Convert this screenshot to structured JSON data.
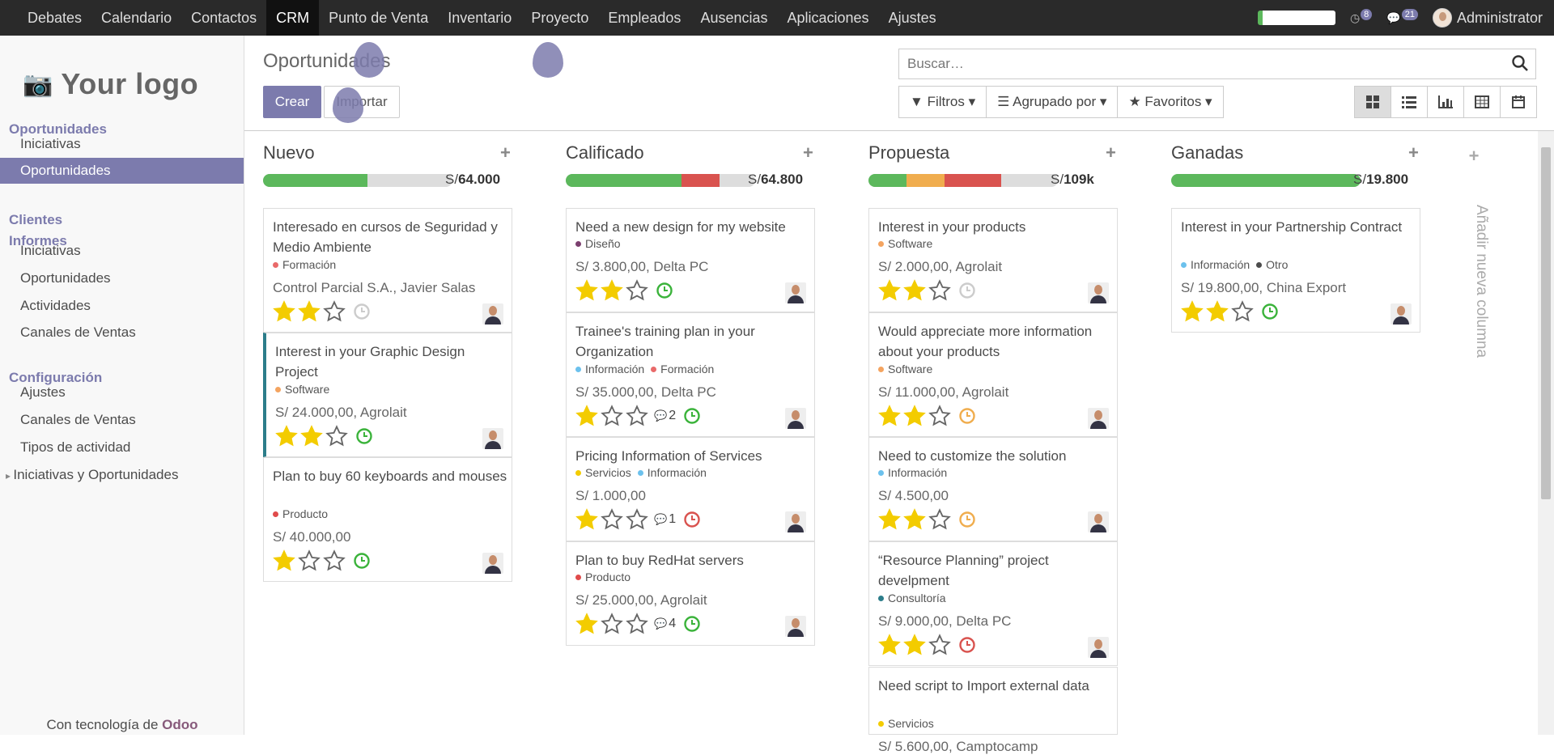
{
  "topbar": {
    "menu": [
      "Debates",
      "Calendario",
      "Contactos",
      "CRM",
      "Punto de Venta",
      "Inventario",
      "Proyecto",
      "Empleados",
      "Ausencias",
      "Aplicaciones",
      "Ajustes"
    ],
    "active_menu": "CRM",
    "activity_count": "8",
    "message_count": "21",
    "user": "Administrator"
  },
  "sidebar": {
    "logo_text": "Your logo",
    "sections": [
      {
        "title": "Oportunidades",
        "items": [
          "Iniciativas",
          "Oportunidades"
        ]
      },
      {
        "title": "Clientes",
        "items": []
      },
      {
        "title": "Informes",
        "items": [
          "Iniciativas",
          "Oportunidades",
          "Actividades",
          "Canales de Ventas"
        ]
      },
      {
        "title": "Configuración",
        "items": [
          "Ajustes",
          "Canales de Ventas",
          "Tipos de actividad",
          "Iniciativas y Oportunidades"
        ]
      }
    ],
    "active_item": "Oportunidades",
    "powered_prefix": "Con tecnología de",
    "powered_brand": "Odoo"
  },
  "control_panel": {
    "title": "Oportunidades",
    "create_label": "Crear",
    "import_label": "Importar",
    "search_placeholder": "Buscar…",
    "filters_label": "Filtros",
    "groupby_label": "Agrupado por",
    "favorites_label": "Favoritos",
    "views": [
      "kanban",
      "list",
      "graph",
      "pivot",
      "calendar"
    ],
    "active_view": "kanban"
  },
  "colors": {
    "brand": "#7c7bad",
    "green": "#5cb85c",
    "orange": "#f0ad4e",
    "red": "#d9534f",
    "star": "#f3cc00"
  },
  "columns": [
    {
      "title": "Nuevo",
      "sum_prefix": "S/",
      "sum": "64.000",
      "progress": [
        {
          "color": "#5cb85c",
          "pct": 0.55
        }
      ],
      "cards": [
        {
          "name": "Interesado en cursos de Seguridad y Medio Ambiente",
          "tags": [
            {
              "label": "Formación",
              "color": "#e96a6a"
            }
          ],
          "amount": "Control Parcial S.A., Javier Salas",
          "stars": 2,
          "clock": "gray",
          "msgs": ""
        },
        {
          "name": "Interest in your Graphic Design Project",
          "tags": [
            {
              "label": "Software",
              "color": "#f4a460"
            }
          ],
          "amount": "S/ 24.000,00, Agrolait",
          "stars": 2,
          "clock": "green",
          "msgs": "",
          "selected": true
        },
        {
          "name": "Plan to buy 60 keyboards and mouses",
          "tags": [
            {
              "label": "Producto",
              "color": "#e04b4b"
            }
          ],
          "amount": "S/ 40.000,00",
          "stars": 1,
          "clock": "green",
          "msgs": ""
        }
      ]
    },
    {
      "title": "Calificado",
      "sum_prefix": "S/",
      "sum": "64.800",
      "progress": [
        {
          "color": "#5cb85c",
          "pct": 0.61
        },
        {
          "color": "#d9534f",
          "pct": 0.2
        }
      ],
      "cards": [
        {
          "name": "Need a new design for my website",
          "tags": [
            {
              "label": "Diseño",
              "color": "#7b3f6e"
            }
          ],
          "amount": "S/ 3.800,00, Delta PC",
          "stars": 2,
          "clock": "green",
          "msgs": ""
        },
        {
          "name": "Trainee's training plan in your Organization",
          "tags": [
            {
              "label": "Información",
              "color": "#6cc1ed"
            },
            {
              "label": "Formación",
              "color": "#e96a6a"
            }
          ],
          "amount": "S/ 35.000,00, Delta PC",
          "stars": 1,
          "clock": "green",
          "msgs": "2"
        },
        {
          "name": "Pricing Information of Services",
          "tags": [
            {
              "label": "Servicios",
              "color": "#f3cc00"
            },
            {
              "label": "Información",
              "color": "#6cc1ed"
            }
          ],
          "amount": "S/ 1.000,00",
          "stars": 1,
          "clock": "red",
          "msgs": "1"
        },
        {
          "name": "Plan to buy RedHat servers",
          "tags": [
            {
              "label": "Producto",
              "color": "#e04b4b"
            }
          ],
          "amount": "S/ 25.000,00, Agrolait",
          "stars": 1,
          "clock": "green",
          "msgs": "4"
        }
      ]
    },
    {
      "title": "Propuesta",
      "sum_prefix": "S/",
      "sum": "109k",
      "progress": [
        {
          "color": "#5cb85c",
          "pct": 0.2
        },
        {
          "color": "#f0ad4e",
          "pct": 0.2
        },
        {
          "color": "#d9534f",
          "pct": 0.3
        }
      ],
      "cards": [
        {
          "name": "Interest in your products",
          "tags": [
            {
              "label": "Software",
              "color": "#f4a460"
            }
          ],
          "amount": "S/ 2.000,00, Agrolait",
          "stars": 2,
          "clock": "gray",
          "msgs": ""
        },
        {
          "name": "Would appreciate more information about your products",
          "tags": [
            {
              "label": "Software",
              "color": "#f4a460"
            }
          ],
          "amount": "S/ 11.000,00, Agrolait",
          "stars": 2,
          "clock": "orange",
          "msgs": ""
        },
        {
          "name": "Need to customize the solution",
          "tags": [
            {
              "label": "Información",
              "color": "#6cc1ed"
            }
          ],
          "amount": "S/ 4.500,00",
          "stars": 2,
          "clock": "orange",
          "msgs": ""
        },
        {
          "name": "“Resource Planning” project develpment",
          "tags": [
            {
              "label": "Consultoría",
              "color": "#2c7d8a"
            }
          ],
          "amount": "S/ 9.000,00, Delta PC",
          "stars": 2,
          "clock": "red",
          "msgs": ""
        },
        {
          "name": "Need script to Import external data",
          "tags": [
            {
              "label": "Servicios",
              "color": "#f3cc00"
            }
          ],
          "amount": "S/ 5.600,00, Camptocamp",
          "stars": 0,
          "clock": "",
          "msgs": ""
        }
      ]
    },
    {
      "title": "Ganadas",
      "sum_prefix": "S/",
      "sum": "19.800",
      "progress": [
        {
          "color": "#5cb85c",
          "pct": 1.0
        }
      ],
      "cards": [
        {
          "name": "Interest in your Partnership Contract",
          "tags": [
            {
              "label": "Información",
              "color": "#6cc1ed"
            },
            {
              "label": "Otro",
              "color": "#4c4c4c"
            }
          ],
          "amount": "S/ 19.800,00, China Export",
          "stars": 2,
          "clock": "green",
          "msgs": ""
        }
      ]
    }
  ],
  "add_column_label": "Añadir nueva columna"
}
